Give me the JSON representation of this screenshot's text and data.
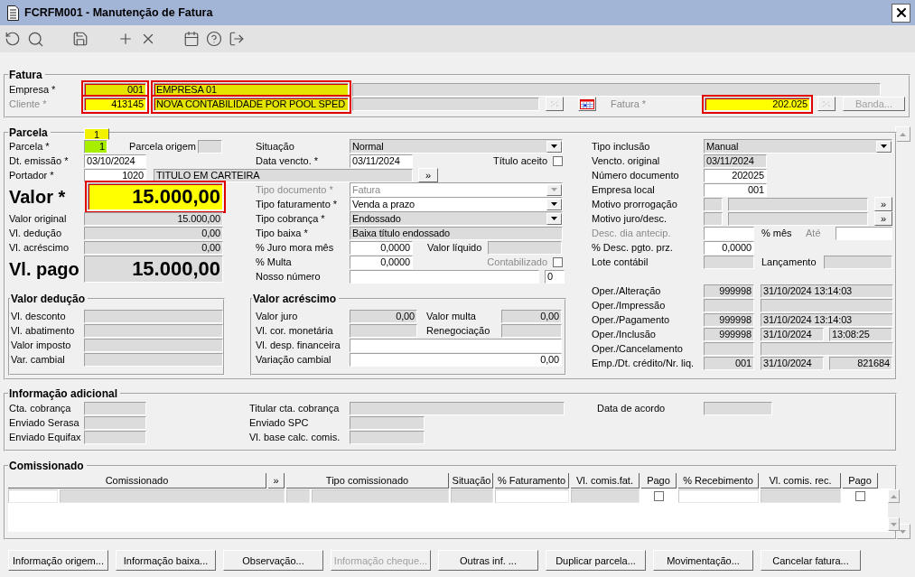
{
  "window": {
    "title": "FCRFM001 - Manutenção de Fatura"
  },
  "fatura": {
    "title": "Fatura",
    "rows": [
      {
        "items": [
          {
            "kind": "label",
            "text": "Empresa *"
          },
          {
            "kind": "text",
            "value": "001",
            "readonly": true,
            "highlighted": true,
            "outlined": true
          },
          {
            "kind": "text",
            "value": "EMPRESA 01",
            "readonly": true,
            "highlighted": true,
            "outlined": true
          },
          {
            "kind": "text",
            "readonly": true
          }
        ]
      },
      {
        "items": [
          {
            "kind": "label",
            "text": "Cliente *",
            "disabled": true
          },
          {
            "kind": "text",
            "value": "413145",
            "readonly": false,
            "highlighted": true,
            "outlined": true
          },
          {
            "kind": "text",
            "value": "NOVA CONTABILIDADE POR POOL SPED",
            "readonly": true,
            "highlighted": true,
            "outlined": true
          },
          {
            "kind": "text",
            "readonly": true
          },
          {
            "kind": "picker",
            "disabled": true
          },
          {
            "kind": "calendar",
            "disabled": false
          },
          {
            "kind": "label",
            "text": "Fatura *",
            "disabled": true
          },
          {
            "kind": "text",
            "value": "202.025",
            "readonly": false,
            "highlighted": true,
            "outlined": true
          },
          {
            "kind": "picker",
            "disabled": true
          },
          {
            "kind": "button",
            "label": "Banda...",
            "disabled": true
          }
        ]
      }
    ]
  },
  "parcela": {
    "title": "Parcela",
    "tab": {
      "label": "1",
      "selected": true
    },
    "top_rows": [
      {
        "items": [
          {
            "kind": "label",
            "text": "Parcela *"
          },
          {
            "kind": "text",
            "value": "1",
            "readonly": false,
            "focused": true
          },
          {
            "kind": "label",
            "text": "Parcela origem"
          },
          {
            "kind": "text",
            "readonly": true
          },
          {
            "kind": "label",
            "text": "Situação"
          },
          {
            "kind": "select",
            "value": "Normal",
            "readonly": true
          }
        ]
      },
      {
        "items": [
          {
            "kind": "label",
            "text": "Dt. emissão *"
          },
          {
            "kind": "text",
            "value": "03/10/2024",
            "readonly": false
          },
          {
            "kind": "label",
            "text": "Data vencto. *"
          },
          {
            "kind": "text",
            "value": "03/11/2024",
            "readonly": false
          },
          {
            "kind": "label",
            "text": "Título aceito"
          },
          {
            "kind": "check",
            "checked": false
          }
        ]
      },
      {
        "items": [
          {
            "kind": "label",
            "text": "Portador *"
          },
          {
            "kind": "text",
            "value": "1020",
            "readonly": false
          },
          {
            "kind": "text",
            "value": "TITULO EM CARTEIRA",
            "readonly": true
          },
          {
            "kind": "button",
            "label": "»"
          }
        ]
      }
    ],
    "left_rows": [
      {
        "kind": "total",
        "items": [
          {
            "kind": "label",
            "text": "Valor *"
          },
          {
            "kind": "text",
            "value": "15.000,00",
            "readonly": false,
            "highlighted": true,
            "outlined": true
          }
        ]
      },
      {
        "kind": "normal",
        "items": [
          {
            "kind": "label",
            "text": "Valor original"
          },
          {
            "kind": "text",
            "value": "15.000,00",
            "readonly": true
          }
        ]
      },
      {
        "kind": "normal",
        "items": [
          {
            "kind": "label",
            "text": "Vl. dedução"
          },
          {
            "kind": "text",
            "value": "0,00",
            "readonly": true
          }
        ]
      },
      {
        "kind": "normal",
        "items": [
          {
            "kind": "label",
            "text": "Vl. acréscimo"
          },
          {
            "kind": "text",
            "value": "0,00",
            "readonly": true
          }
        ]
      },
      {
        "kind": "total",
        "items": [
          {
            "kind": "label",
            "text": "Vl. pago"
          },
          {
            "kind": "text",
            "value": "15.000,00",
            "readonly": true
          }
        ]
      }
    ],
    "middle_rows": [
      {
        "items": [
          {
            "kind": "label",
            "text": "Tipo documento *",
            "disabled": true
          },
          {
            "kind": "select",
            "value": "Fatura",
            "readonly": false,
            "disabled": true
          }
        ]
      },
      {
        "items": [
          {
            "kind": "label",
            "text": "Tipo faturamento *"
          },
          {
            "kind": "select",
            "value": "Venda a prazo",
            "readonly": false
          }
        ]
      },
      {
        "items": [
          {
            "kind": "label",
            "text": "Tipo cobrança *"
          },
          {
            "kind": "select",
            "value": "Endossado",
            "readonly": true
          }
        ]
      },
      {
        "items": [
          {
            "kind": "label",
            "text": "Tipo baixa *"
          },
          {
            "kind": "text",
            "value": "Baixa título endossado",
            "readonly": true
          }
        ]
      },
      {
        "items": [
          {
            "kind": "label",
            "text": "% Juro mora mês"
          },
          {
            "kind": "text",
            "value": "0,0000",
            "readonly": false
          },
          {
            "kind": "label",
            "text": "Valor líquido"
          },
          {
            "kind": "text",
            "readonly": true
          }
        ]
      },
      {
        "items": [
          {
            "kind": "label",
            "text": "% Multa"
          },
          {
            "kind": "text",
            "value": "0,0000",
            "readonly": false
          },
          {
            "kind": "label",
            "text": "Contabilizado",
            "disabled": true
          },
          {
            "kind": "check",
            "checked": false
          }
        ]
      },
      {
        "items": [
          {
            "kind": "label",
            "text": "Nosso número"
          },
          {
            "kind": "text",
            "readonly": false
          },
          {
            "kind": "text",
            "value": "0",
            "readonly": false
          }
        ]
      }
    ],
    "right_rows": [
      {
        "items": [
          {
            "kind": "label",
            "text": "Tipo inclusão"
          },
          {
            "kind": "select",
            "value": "Manual",
            "readonly": true
          }
        ]
      },
      {
        "items": [
          {
            "kind": "label",
            "text": "Vencto. original"
          },
          {
            "kind": "text",
            "value": "03/11/2024",
            "readonly": true
          }
        ]
      },
      {
        "items": [
          {
            "kind": "label",
            "text": "Número documento"
          },
          {
            "kind": "text",
            "value": "202025",
            "readonly": false
          }
        ]
      },
      {
        "items": [
          {
            "kind": "label",
            "text": "Empresa local"
          },
          {
            "kind": "text",
            "value": "001",
            "readonly": false
          }
        ]
      },
      {
        "items": [
          {
            "kind": "label",
            "text": "Motivo prorrogação"
          },
          {
            "kind": "text",
            "readonly": true
          },
          {
            "kind": "text",
            "readonly": true
          },
          {
            "kind": "button",
            "label": "»"
          }
        ]
      },
      {
        "items": [
          {
            "kind": "label",
            "text": "Motivo juro/desc."
          },
          {
            "kind": "text",
            "readonly": true
          },
          {
            "kind": "text",
            "readonly": true
          },
          {
            "kind": "button",
            "label": "»"
          }
        ]
      },
      {
        "items": [
          {
            "kind": "label",
            "text": "Desc. dia antecip.",
            "disabled": true
          },
          {
            "kind": "text",
            "readonly": false
          },
          {
            "kind": "label",
            "text": "% mês"
          },
          {
            "kind": "label",
            "text": "Até",
            "disabled": true
          },
          {
            "kind": "text",
            "readonly": false
          }
        ]
      },
      {
        "items": [
          {
            "kind": "label",
            "text": "% Desc. pgto. prz."
          },
          {
            "kind": "text",
            "value": "0,0000",
            "readonly": false
          }
        ]
      },
      {
        "items": [
          {
            "kind": "label",
            "text": "Lote contábil"
          },
          {
            "kind": "text",
            "readonly": true
          },
          {
            "kind": "label",
            "text": "Lançamento"
          },
          {
            "kind": "text",
            "readonly": true
          }
        ]
      }
    ],
    "operator_rows": [
      {
        "items": [
          {
            "kind": "label",
            "text": "Oper./Alteração"
          },
          {
            "kind": "text",
            "value": "999998",
            "readonly": true
          },
          {
            "kind": "text",
            "value": "31/10/2024 13:14:03",
            "readonly": true
          }
        ]
      },
      {
        "items": [
          {
            "kind": "label",
            "text": "Oper./Impressão"
          },
          {
            "kind": "text",
            "readonly": true
          },
          {
            "kind": "text",
            "readonly": true
          }
        ]
      },
      {
        "items": [
          {
            "kind": "label",
            "text": "Oper./Pagamento"
          },
          {
            "kind": "text",
            "value": "999998",
            "readonly": true
          },
          {
            "kind": "text",
            "value": "31/10/2024 13:14:03",
            "readonly": true
          }
        ]
      },
      {
        "items": [
          {
            "kind": "label",
            "text": "Oper./Inclusão"
          },
          {
            "kind": "text",
            "value": "999998",
            "readonly": true
          },
          {
            "kind": "text",
            "value": "31/10/2024",
            "readonly": true
          },
          {
            "kind": "text",
            "value": "13:08:25",
            "readonly": true
          }
        ]
      },
      {
        "items": [
          {
            "kind": "label",
            "text": "Oper./Cancelamento"
          },
          {
            "kind": "text",
            "readonly": true
          },
          {
            "kind": "text",
            "readonly": true
          }
        ]
      },
      {
        "items": [
          {
            "kind": "label",
            "text": "Emp./Dt. crédito/Nr. liq."
          },
          {
            "kind": "text",
            "value": "001",
            "readonly": true
          },
          {
            "kind": "text",
            "value": "31/10/2024",
            "readonly": true
          },
          {
            "kind": "text",
            "value": "821684",
            "readonly": true
          }
        ]
      }
    ],
    "deducao": {
      "title": "Valor dedução",
      "rows": [
        {
          "items": [
            {
              "kind": "label",
              "text": "Vl. desconto"
            },
            {
              "kind": "text",
              "readonly": true
            }
          ]
        },
        {
          "items": [
            {
              "kind": "label",
              "text": "Vl. abatimento"
            },
            {
              "kind": "text",
              "readonly": true
            }
          ]
        },
        {
          "items": [
            {
              "kind": "label",
              "text": "Valor imposto"
            },
            {
              "kind": "text",
              "readonly": true
            }
          ]
        },
        {
          "items": [
            {
              "kind": "label",
              "text": "Var. cambial"
            },
            {
              "kind": "text",
              "readonly": true
            }
          ]
        }
      ]
    },
    "acrescimo": {
      "title": "Valor acréscimo",
      "rows": [
        {
          "items": [
            {
              "kind": "label",
              "text": "Valor juro"
            },
            {
              "kind": "text",
              "value": "0,00",
              "readonly": true
            },
            {
              "kind": "label",
              "text": "Valor multa"
            },
            {
              "kind": "text",
              "value": "0,00",
              "readonly": true
            }
          ]
        },
        {
          "items": [
            {
              "kind": "label",
              "text": "Vl. cor. monetária"
            },
            {
              "kind": "text",
              "readonly": true
            },
            {
              "kind": "label",
              "text": "Renegociação"
            },
            {
              "kind": "text",
              "readonly": true
            }
          ]
        },
        {
          "items": [
            {
              "kind": "label",
              "text": "Vl. desp. financeira"
            },
            {
              "kind": "text",
              "readonly": false
            }
          ]
        },
        {
          "items": [
            {
              "kind": "label",
              "text": "Variação cambial"
            },
            {
              "kind": "text",
              "value": "0,00",
              "readonly": false
            }
          ]
        }
      ]
    }
  },
  "informacao_adicional": {
    "title": "Informação adicional",
    "rows": [
      {
        "items": [
          {
            "kind": "label",
            "text": "Cta. cobrança"
          },
          {
            "kind": "text",
            "readonly": true
          },
          {
            "kind": "label",
            "text": "Titular cta. cobrança"
          },
          {
            "kind": "text",
            "readonly": true
          },
          {
            "kind": "label",
            "text": "Data de acordo"
          },
          {
            "kind": "text",
            "readonly": true
          }
        ]
      },
      {
        "items": [
          {
            "kind": "label",
            "text": "Enviado Serasa"
          },
          {
            "kind": "text",
            "readonly": true
          },
          {
            "kind": "label",
            "text": "Enviado SPC"
          },
          {
            "kind": "text",
            "readonly": true
          }
        ]
      },
      {
        "items": [
          {
            "kind": "label",
            "text": "Enviado Equifax"
          },
          {
            "kind": "text",
            "readonly": true
          },
          {
            "kind": "label",
            "text": "Vl. base calc. comis."
          },
          {
            "kind": "text",
            "readonly": true
          }
        ]
      }
    ]
  },
  "comissionado": {
    "title": "Comissionado",
    "columns": [
      "Comissionado",
      "»",
      "Tipo comissionado",
      "Situação",
      "% Faturamento",
      "Vl. comis.fat.",
      "Pago",
      "% Recebimento",
      "Vl. comis. rec.",
      "Pago"
    ],
    "rows": [
      {
        "cells": [
          {
            "kind": "text",
            "readonly": false
          },
          {
            "kind": "text",
            "readonly": true
          },
          {
            "kind": "text",
            "readonly": true
          },
          {
            "kind": "text",
            "readonly": true
          },
          {
            "kind": "text",
            "readonly": true
          },
          {
            "kind": "text",
            "readonly": false
          },
          {
            "kind": "text",
            "readonly": true
          },
          {
            "kind": "check",
            "checked": false
          },
          {
            "kind": "text",
            "readonly": false
          },
          {
            "kind": "text",
            "readonly": true
          },
          {
            "kind": "check",
            "checked": false
          }
        ]
      }
    ]
  },
  "buttons": [
    {
      "label": "Informação origem...",
      "disabled": false
    },
    {
      "label": "Informação baixa...",
      "disabled": false
    },
    {
      "label": "Observação...",
      "disabled": false
    },
    {
      "label": "Informação cheque...",
      "disabled": true
    },
    {
      "label": "Outras inf. ...",
      "disabled": false
    },
    {
      "label": "Duplicar parcela...",
      "disabled": false
    },
    {
      "label": "Movimentação...",
      "disabled": false
    },
    {
      "label": "Cancelar fatura...",
      "disabled": false
    }
  ]
}
